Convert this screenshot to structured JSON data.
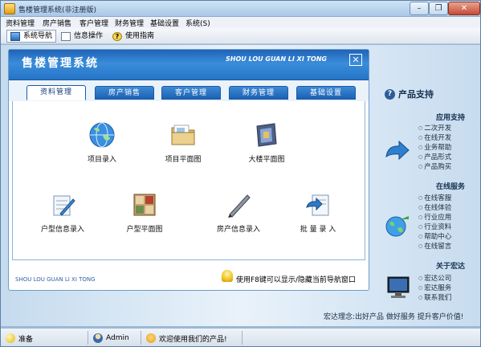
{
  "window": {
    "title": "售楼管理系统(非注册版)"
  },
  "menubar": [
    "资料管理",
    "房产销售",
    "客户管理",
    "财务管理",
    "基础设置",
    "系统(S)"
  ],
  "toolbar": {
    "items": [
      "系统导航",
      "信息操作",
      "使用指南"
    ]
  },
  "panel": {
    "title": "售楼管理系统",
    "subtitle": "SHOU LOU GUAN LI XI TONG",
    "tabs": [
      "资料管理",
      "房产销售",
      "客户管理",
      "财务管理",
      "基础设置"
    ],
    "items": [
      {
        "label": "项目录入",
        "icon": "globe-icon"
      },
      {
        "label": "项目平面图",
        "icon": "folder-icon"
      },
      {
        "label": "大楼平面图",
        "icon": "building-icon"
      },
      {
        "label": "户型信息录入",
        "icon": "notepad-pen-icon"
      },
      {
        "label": "户型平面图",
        "icon": "floorplan-icon"
      },
      {
        "label": "房产信息录入",
        "icon": "pen-icon"
      },
      {
        "label": "批 量 录 入",
        "icon": "batch-notepad-icon"
      }
    ],
    "footer_brand": "SHOU LOU GUAN LI XI TONG",
    "footer_tip": "使用F8键可以显示/隐藏当前导航窗口"
  },
  "right_panel": {
    "title": "产品支持",
    "sections": [
      {
        "title": "应用支持",
        "items": [
          "二次开发",
          "在线开发",
          "业务帮助",
          "产品形式",
          "产品购买"
        ]
      },
      {
        "title": "在线服务",
        "items": [
          "在线客服",
          "在线体验",
          "行业应用",
          "行业资料",
          "帮助中心",
          "在线留言"
        ]
      },
      {
        "title": "关于宏达",
        "items": [
          "宏达公司",
          "宏达服务",
          "联系我们"
        ]
      }
    ]
  },
  "slogan": "宏达理念:出好产品 做好服务 提升客户价值!",
  "statusbar": {
    "ready": "准备",
    "user": "Admin",
    "welcome": "欢迎使用我们的产品!"
  },
  "colors": {
    "header_blue": "#2675c7",
    "tab_blue": "#1c61b3",
    "panel_bg": "#c5dbee"
  }
}
